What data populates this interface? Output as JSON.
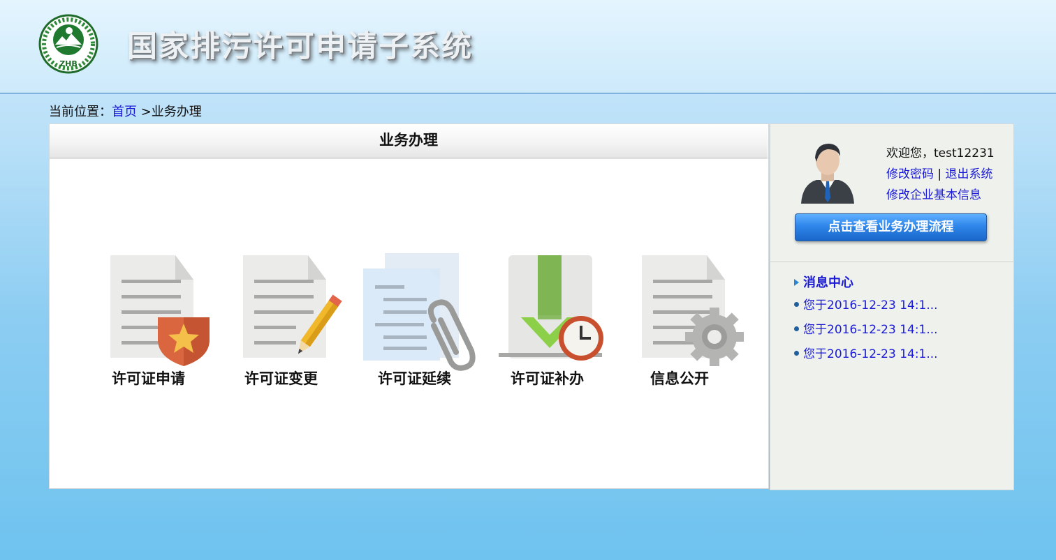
{
  "header": {
    "logo_text": "ZHB",
    "system_title": "国家排污许可申请子系统"
  },
  "breadcrumb": {
    "prefix": "当前位置：",
    "home_link": "首页",
    "current": " >业务办理"
  },
  "main": {
    "panel_title": "业务办理",
    "tiles": [
      {
        "label": "许可证申请",
        "icon": "document-shield-icon"
      },
      {
        "label": "许可证变更",
        "icon": "document-pencil-icon"
      },
      {
        "label": "许可证延续",
        "icon": "document-paperclip-icon"
      },
      {
        "label": "许可证补办",
        "icon": "download-clock-icon"
      },
      {
        "label": "信息公开",
        "icon": "document-gear-icon"
      }
    ]
  },
  "sidebar": {
    "welcome": "欢迎您，test12231",
    "change_password": "修改密码",
    "separator": " | ",
    "logout": "退出系统",
    "edit_company_info": "修改企业基本信息",
    "flow_button": "点击查看业务办理流程",
    "message_center": "消息中心",
    "messages": [
      "您于2016-12-23 14:1...",
      "您于2016-12-23 14:1...",
      "您于2016-12-23 14:1..."
    ]
  },
  "colors": {
    "link": "#1a1ad6",
    "accent_button": "#2f86ea",
    "header_rule": "#2a6fb8"
  }
}
